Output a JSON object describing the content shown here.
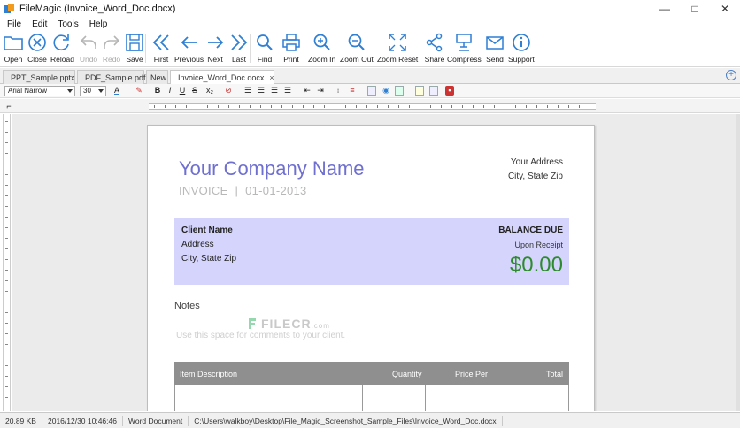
{
  "window": {
    "title": "FileMagic (Invoice_Word_Doc.docx)",
    "minimize": "—",
    "maximize": "□",
    "close": "✕"
  },
  "menu": [
    "File",
    "Edit",
    "Tools",
    "Help"
  ],
  "toolbar": {
    "open": "Open",
    "close": "Close",
    "reload": "Reload",
    "undo": "Undo",
    "redo": "Redo",
    "save": "Save",
    "first": "First",
    "previous": "Previous",
    "next": "Next",
    "last": "Last",
    "find": "Find",
    "print": "Print",
    "zoom_in": "Zoom In",
    "zoom_out": "Zoom Out",
    "zoom_reset": "Zoom Reset",
    "share": "Share",
    "compress": "Compress",
    "send": "Send",
    "support": "Support"
  },
  "tabs": [
    {
      "label": "PPT_Sample.pptx"
    },
    {
      "label": "PDF_Sample.pdf"
    },
    {
      "label": "New"
    },
    {
      "label": "Invoice_Word_Doc.docx"
    }
  ],
  "tab_close": "×",
  "tab_add": "+",
  "format": {
    "font": "Arial Narrow",
    "size": "30",
    "bold": "B",
    "italic": "I",
    "underline": "U",
    "strike": "S",
    "text_color": "A"
  },
  "document": {
    "company": "Your Company Name",
    "invoice_label": "INVOICE",
    "invoice_sep": "|",
    "invoice_date": "01-01-2013",
    "address_line1": "Your Address",
    "address_line2": "City, State Zip",
    "client_name": "Client Name",
    "client_address": "Address",
    "client_city": "City, State Zip",
    "balance_label": "BALANCE DUE",
    "balance_terms": "Upon Receipt",
    "balance_amount": "$0.00",
    "notes_heading": "Notes",
    "notes_placeholder": "Use this space for comments to your client.",
    "table_headers": [
      "Item Description",
      "Quantity",
      "Price Per",
      "Total"
    ]
  },
  "watermark": {
    "text": "FILECR",
    "suffix": ".com"
  },
  "status": {
    "size": "20.89 KB",
    "date": "2016/12/30 10:46:46",
    "type": "Word Document",
    "path": "C:\\Users\\walkboy\\Desktop\\File_Magic_Screenshot_Sample_Files\\Invoice_Word_Doc.docx"
  },
  "colors": {
    "accent": "#2f7fd4",
    "company": "#6f6fd0",
    "client_box": "#d4d4fc",
    "amount": "#2d8a2d"
  }
}
